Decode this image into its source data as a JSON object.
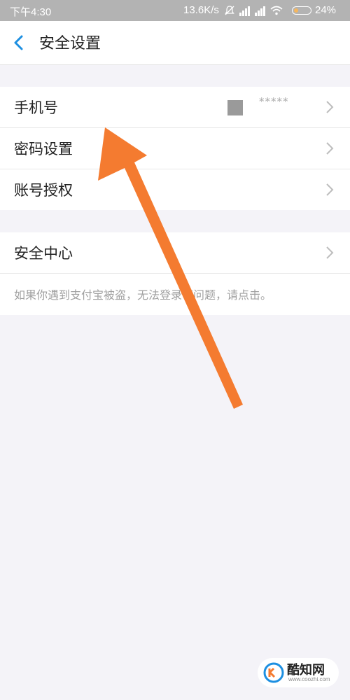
{
  "status_bar": {
    "time": "下午4:30",
    "network_speed": "13.6K/s",
    "battery": "24%",
    "icons": [
      "mute-icon",
      "signal-icon",
      "hd-signal-icon",
      "wifi-icon",
      "battery-icon"
    ]
  },
  "navbar": {
    "title": "安全设置",
    "back_icon": "chevron-left-icon"
  },
  "group1": {
    "items": [
      {
        "label": "手机号",
        "value": "*****"
      },
      {
        "label": "密码设置"
      },
      {
        "label": "账号授权"
      }
    ]
  },
  "group2": {
    "items": [
      {
        "label": "安全中心"
      }
    ],
    "hint": "如果你遇到支付宝被盗，无法登录等问题，请点击。"
  },
  "watermark": {
    "name": "酷知网",
    "url": "www.coozhi.com"
  },
  "colors": {
    "accent": "#1d8fe1",
    "arrow": "#f47b30",
    "background": "#f4f3f8"
  }
}
